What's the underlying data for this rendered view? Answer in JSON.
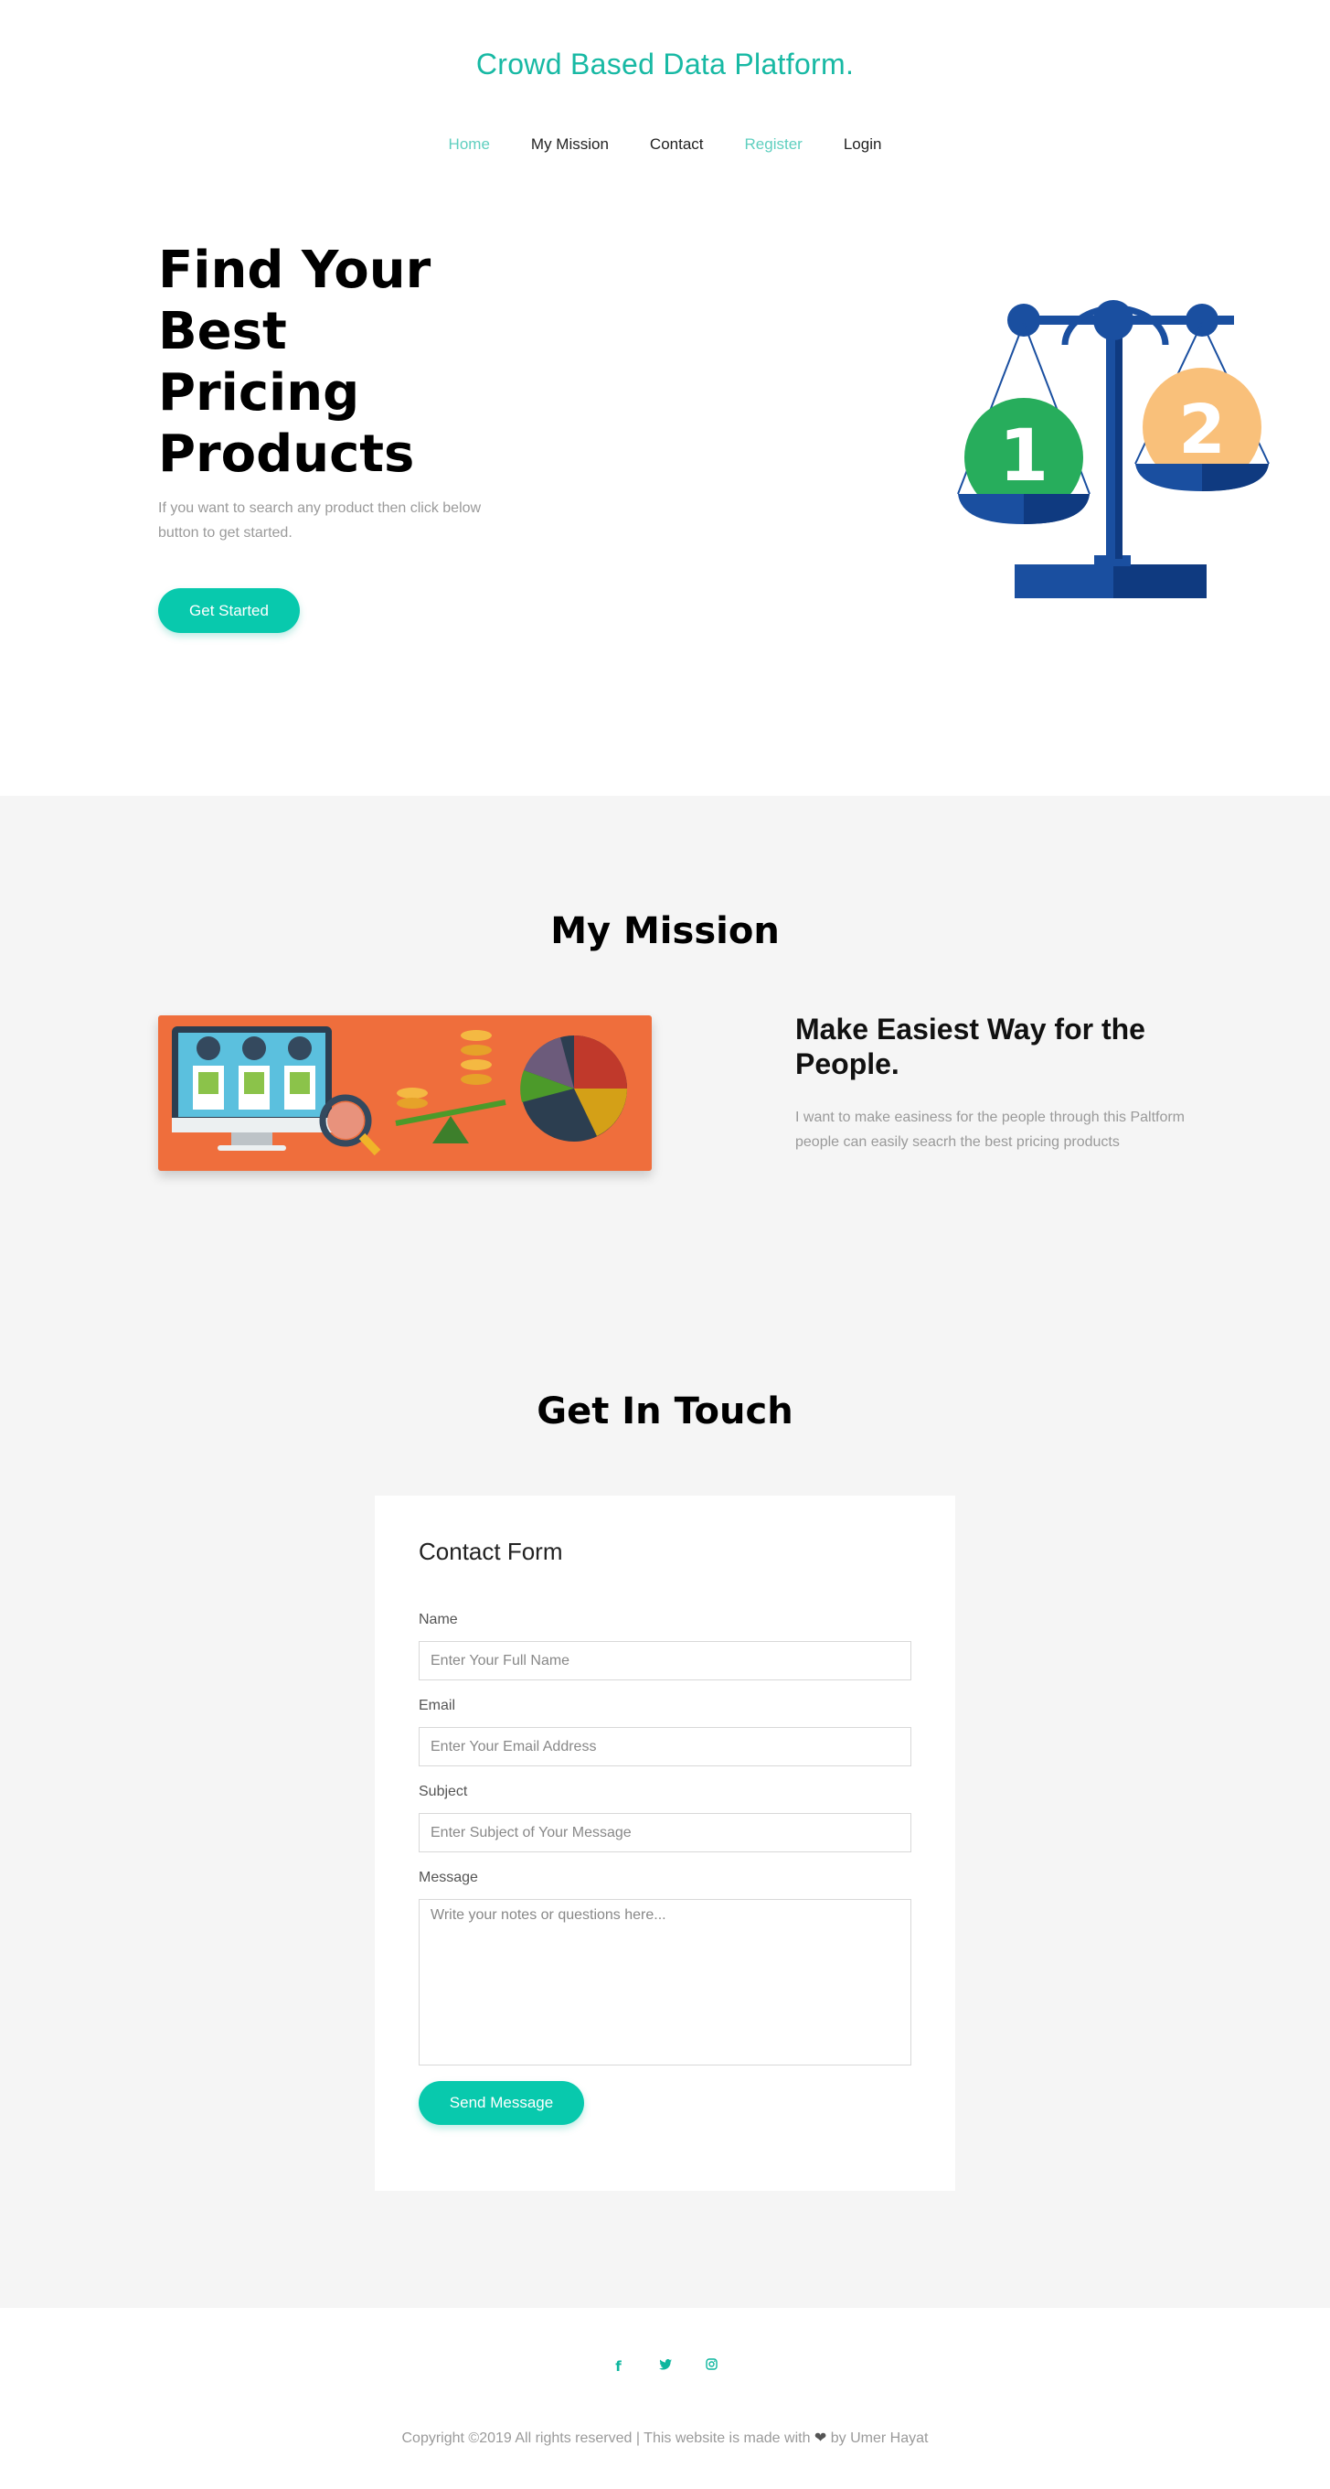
{
  "brand": "Crowd Based Data Platform.",
  "nav": {
    "home": "Home",
    "mission": "My Mission",
    "contact": "Contact",
    "register": "Register",
    "login": "Login"
  },
  "hero": {
    "title": "Find Your Best Pricing Products",
    "subtitle": "If you want to search any product then click below button to get started.",
    "button": "Get Started",
    "scale_labels": [
      "1",
      "2"
    ]
  },
  "mission": {
    "heading": "My Mission",
    "subheading": "Make Easiest Way for the People.",
    "text": "I want to make easiness for the people through this Paltform people can easily seacrh the best pricing products"
  },
  "contact": {
    "heading": "Get In Touch",
    "form_title": "Contact Form",
    "name_label": "Name",
    "name_placeholder": "Enter Your Full Name",
    "email_label": "Email",
    "email_placeholder": "Enter Your Email Address",
    "subject_label": "Subject",
    "subject_placeholder": "Enter Subject of Your Message",
    "message_label": "Message",
    "message_placeholder": "Write your notes or questions here...",
    "send_button": "Send Message"
  },
  "footer": {
    "icons": [
      "facebook-icon",
      "twitter-icon",
      "instagram-icon"
    ],
    "copyright_pre": "Copyright ©2019 All rights reserved | This website is made with",
    "copyright_post": "by Umer Hayat"
  },
  "colors": {
    "accent": "#08c9ad",
    "brand": "#18b9a4",
    "section_bg": "#f5f5f5"
  }
}
